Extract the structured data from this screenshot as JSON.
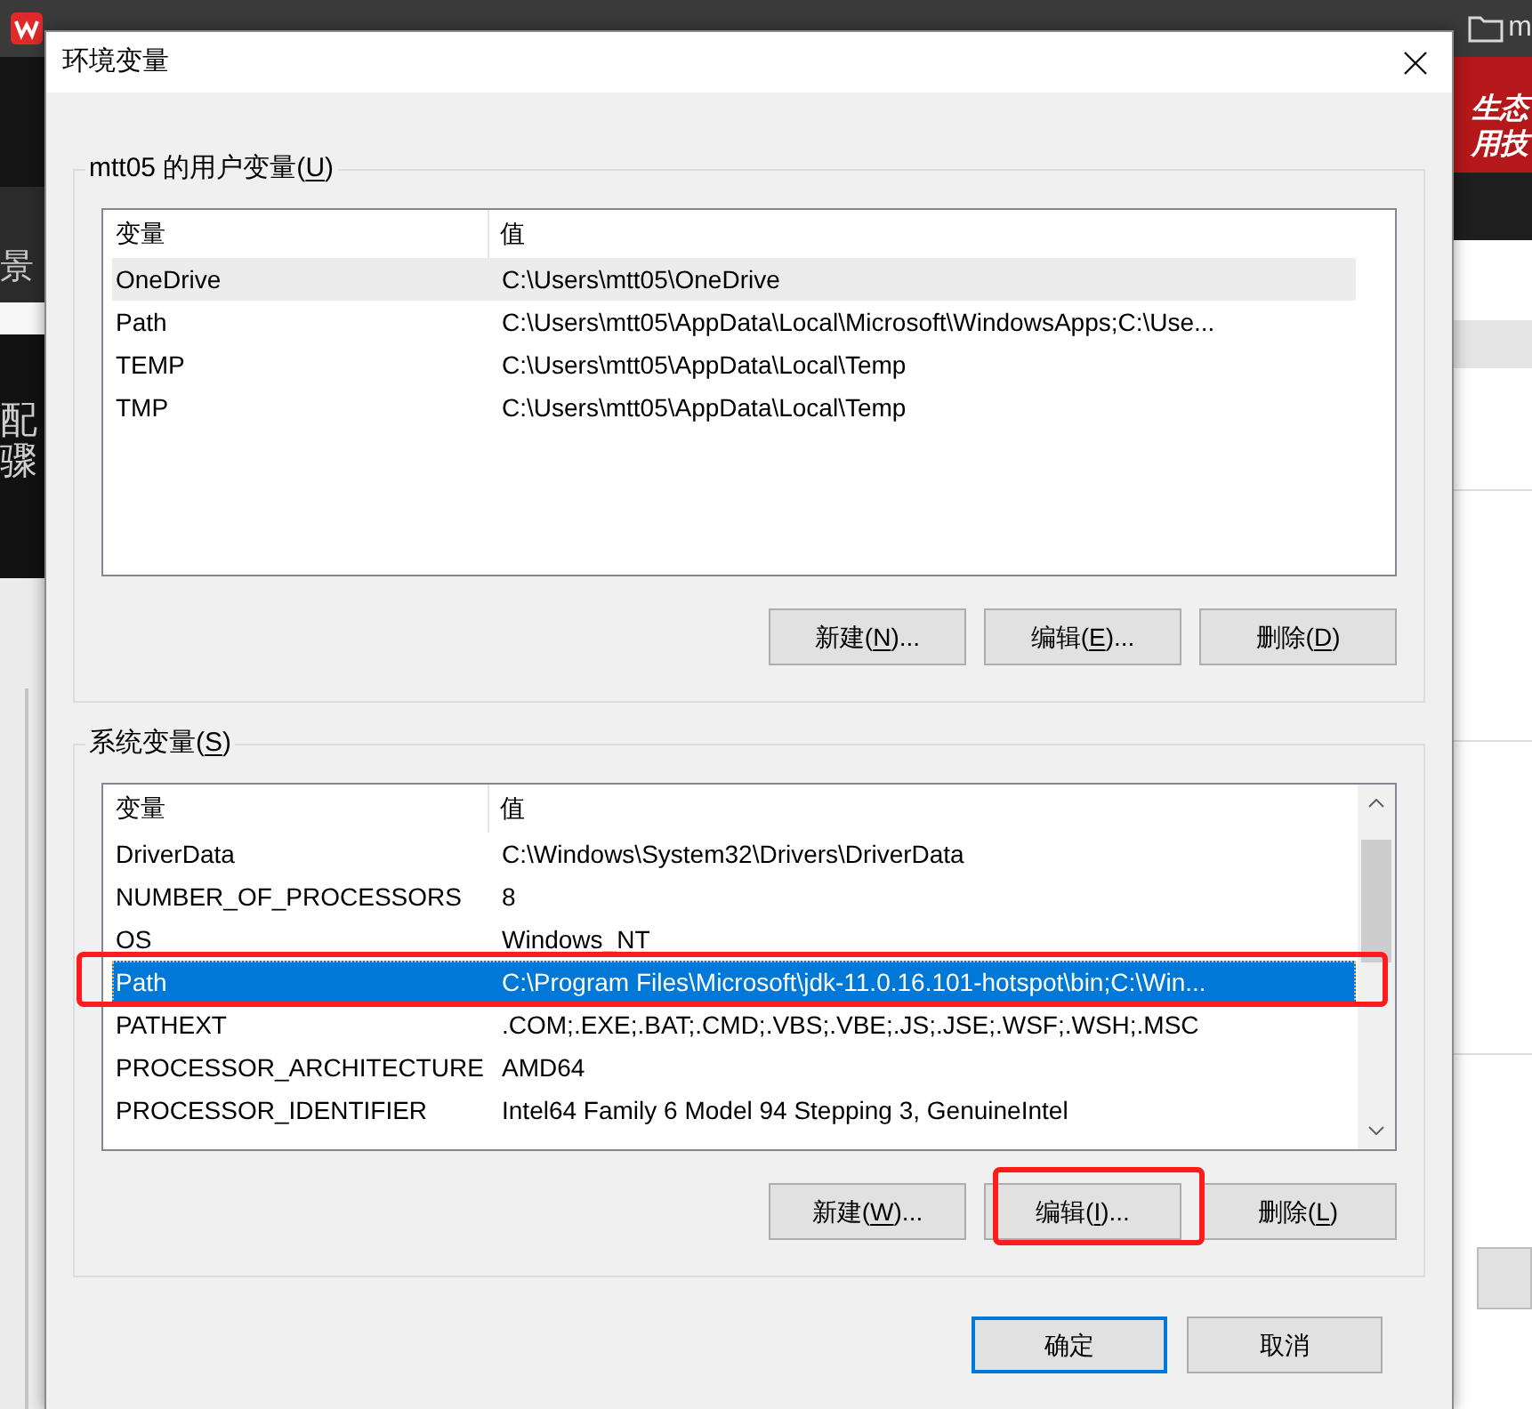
{
  "background": {
    "bookmark_label": "m",
    "left_texts": [
      "景",
      "配",
      "骤"
    ],
    "banner_lines": [
      "生态",
      "用技"
    ]
  },
  "window": {
    "title": "环境变量"
  },
  "user_variables": {
    "label": {
      "before": "mtt05 的用户变量(",
      "key": "U",
      "after": ")"
    },
    "focused": false,
    "scrollable": false,
    "columns": [
      "变量",
      "值"
    ],
    "rows": [
      {
        "name": "OneDrive",
        "value": "C:\\Users\\mtt05\\OneDrive",
        "selected": true,
        "highlighted": false
      },
      {
        "name": "Path",
        "value": "C:\\Users\\mtt05\\AppData\\Local\\Microsoft\\WindowsApps;C:\\Use...",
        "selected": false,
        "highlighted": false
      },
      {
        "name": "TEMP",
        "value": "C:\\Users\\mtt05\\AppData\\Local\\Temp",
        "selected": false,
        "highlighted": false
      },
      {
        "name": "TMP",
        "value": "C:\\Users\\mtt05\\AppData\\Local\\Temp",
        "selected": false,
        "highlighted": false
      }
    ],
    "buttons": [
      {
        "before": "新建(",
        "key": "N",
        "after": ")...",
        "highlighted": false
      },
      {
        "before": "编辑(",
        "key": "E",
        "after": ")...",
        "highlighted": false
      },
      {
        "before": "删除(",
        "key": "D",
        "after": ")",
        "highlighted": false
      }
    ]
  },
  "system_variables": {
    "label": {
      "before": "系统变量(",
      "key": "S",
      "after": ")"
    },
    "focused": true,
    "scrollable": true,
    "columns": [
      "变量",
      "值"
    ],
    "rows": [
      {
        "name": "DriverData",
        "value": "C:\\Windows\\System32\\Drivers\\DriverData",
        "selected": false,
        "highlighted": false
      },
      {
        "name": "NUMBER_OF_PROCESSORS",
        "value": "8",
        "selected": false,
        "highlighted": false
      },
      {
        "name": "OS",
        "value": "Windows_NT",
        "selected": false,
        "highlighted": false
      },
      {
        "name": "Path",
        "value": "C:\\Program Files\\Microsoft\\jdk-11.0.16.101-hotspot\\bin;C:\\Win...",
        "selected": true,
        "highlighted": true
      },
      {
        "name": "PATHEXT",
        "value": ".COM;.EXE;.BAT;.CMD;.VBS;.VBE;.JS;.JSE;.WSF;.WSH;.MSC",
        "selected": false,
        "highlighted": false
      },
      {
        "name": "PROCESSOR_ARCHITECTURE",
        "value": "AMD64",
        "selected": false,
        "highlighted": false
      },
      {
        "name": "PROCESSOR_IDENTIFIER",
        "value": "Intel64 Family 6 Model 94 Stepping 3, GenuineIntel",
        "selected": false,
        "highlighted": false
      }
    ],
    "buttons": [
      {
        "before": "新建(",
        "key": "W",
        "after": ")...",
        "highlighted": false
      },
      {
        "before": "编辑(",
        "key": "I",
        "after": ")...",
        "highlighted": true
      },
      {
        "before": "删除(",
        "key": "L",
        "after": ")",
        "highlighted": false
      }
    ]
  },
  "dialog_buttons": [
    {
      "label": "确定",
      "default": true
    },
    {
      "label": "取消",
      "default": false
    }
  ]
}
